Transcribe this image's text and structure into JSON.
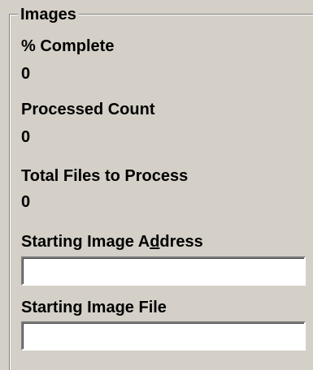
{
  "group": {
    "title": "Images"
  },
  "fields": {
    "percent_complete": {
      "label": "% Complete",
      "value": "0"
    },
    "processed_count": {
      "label": "Processed Count",
      "value": "0"
    },
    "total_files": {
      "label": "Total Files to Process",
      "value": "0"
    },
    "starting_image_address": {
      "label_pre": "Starting Image A",
      "label_underlined": "d",
      "label_post": "dress",
      "value": ""
    },
    "starting_image_file": {
      "label": "Starting Image File",
      "value": ""
    }
  },
  "colors": {
    "background": "#d4d0c8",
    "field_background": "#ffffff",
    "text": "#000000"
  }
}
